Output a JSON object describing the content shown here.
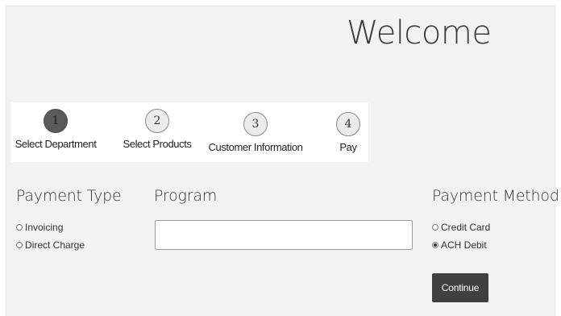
{
  "header": {
    "title": "Welcome"
  },
  "stepper": {
    "steps": [
      {
        "number": "1",
        "label": "Select Department",
        "active": true
      },
      {
        "number": "2",
        "label": "Select Products",
        "active": false
      },
      {
        "number": "3",
        "label": "Customer Information",
        "active": false
      },
      {
        "number": "4",
        "label": "Pay",
        "active": false
      }
    ]
  },
  "payment_type": {
    "title": "Payment Type",
    "options": [
      {
        "label": "Invoicing",
        "checked": false
      },
      {
        "label": "Direct Charge",
        "checked": false
      }
    ]
  },
  "program": {
    "title": "Program",
    "value": "",
    "placeholder": ""
  },
  "payment_method": {
    "title": "Payment Method",
    "options": [
      {
        "label": "Credit Card",
        "checked": false
      },
      {
        "label": "ACH Debit",
        "checked": true
      }
    ]
  },
  "actions": {
    "continue_label": "Continue"
  },
  "colors": {
    "background": "#f2f2f2",
    "button": "#404040",
    "active_step": "#5a5a5a"
  }
}
